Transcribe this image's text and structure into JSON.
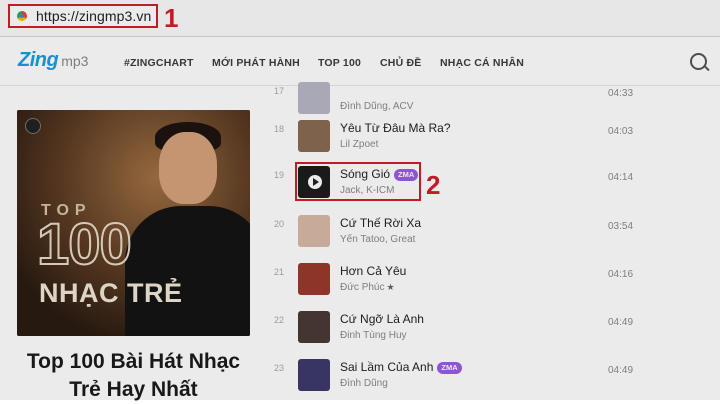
{
  "browser": {
    "url": "https://zingmp3.vn"
  },
  "annotations": {
    "marker_1": "1",
    "marker_2": "2"
  },
  "logo": {
    "brand": "Zing",
    "suffix": "mp3"
  },
  "nav": {
    "items": [
      "#ZINGCHART",
      "MỚI PHÁT HÀNH",
      "TOP 100",
      "CHỦ ĐỀ",
      "NHẠC CÁ NHÂN"
    ]
  },
  "playlist": {
    "cover_top": "TOP",
    "cover_number": "100",
    "cover_label": "NHẠC TRẺ",
    "title": "Top 100 Bài Hát Nhạc Trẻ Hay Nhất"
  },
  "songs": [
    {
      "num": "17",
      "title": "",
      "artist": "Đình Dũng, ACV",
      "duration": "04:33",
      "badge": "",
      "thumb": "#b7b7c7"
    },
    {
      "num": "18",
      "title": "Yêu Từ Đâu Mà Ra?",
      "artist": "Lil Zpoet",
      "duration": "04:03",
      "badge": "",
      "thumb": "#8a6b52"
    },
    {
      "num": "19",
      "title": "Sóng Gió",
      "artist": "Jack, K-ICM",
      "duration": "04:14",
      "badge": "ZMA",
      "thumb": "#1d1d1d"
    },
    {
      "num": "20",
      "title": "Cứ Thế Rời Xa",
      "artist": "Yến Tatoo, Great",
      "duration": "03:54",
      "badge": "",
      "thumb": "#d8b9a6"
    },
    {
      "num": "21",
      "title": "Hơn Cả Yêu",
      "artist": "Đức Phúc",
      "duration": "04:16",
      "badge": "",
      "thumb": "#9b3a2e"
    },
    {
      "num": "22",
      "title": "Cứ Ngỡ Là Anh",
      "artist": "Đinh Tùng Huy",
      "duration": "04:49",
      "badge": "",
      "thumb": "#4a3a35"
    },
    {
      "num": "23",
      "title": "Sai Lầm Của Anh",
      "artist": "Đình Dũng",
      "duration": "04:49",
      "badge": "ZMA",
      "thumb": "#3d3a6b"
    }
  ],
  "icons": {
    "search": "search-icon",
    "favicon": "chrome-favicon-icon",
    "play": "play-icon",
    "star": "star-icon"
  },
  "colors": {
    "accent": "#d0202a",
    "badge": "#9b5de5",
    "logo": "#1a9fe0"
  }
}
